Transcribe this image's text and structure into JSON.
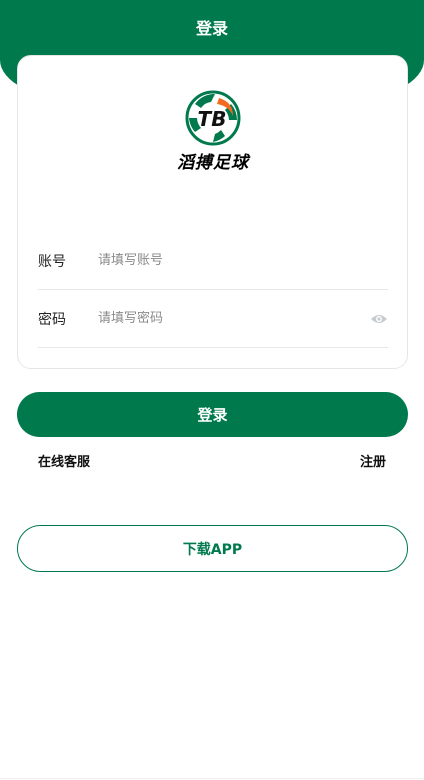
{
  "header": {
    "title": "登录"
  },
  "logo": {
    "icon_text": "TB",
    "brand_name": "滔搏足球"
  },
  "form": {
    "account": {
      "label": "账号",
      "placeholder": "请填写账号",
      "value": ""
    },
    "password": {
      "label": "密码",
      "placeholder": "请填写密码",
      "value": ""
    }
  },
  "actions": {
    "login_label": "登录",
    "customer_service_label": "在线客服",
    "register_label": "注册",
    "download_label": "下载APP"
  },
  "colors": {
    "primary": "#007a4c",
    "accent": "#f26b21"
  },
  "icons": {
    "password_toggle": "eye-icon"
  }
}
